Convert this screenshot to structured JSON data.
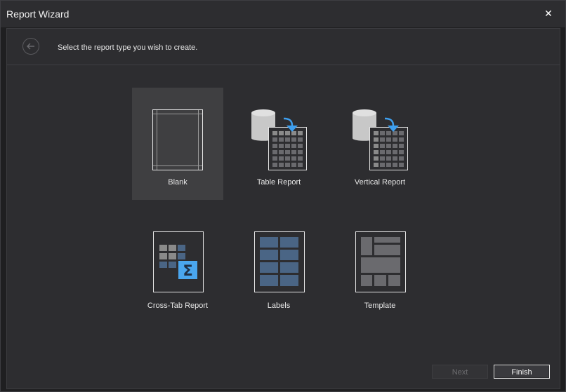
{
  "window": {
    "title": "Report Wizard",
    "close_glyph": "✕"
  },
  "header": {
    "instruction": "Select the report type you wish to create.",
    "back_icon": "arrow-left-circle-icon"
  },
  "report_types": [
    {
      "label": "Blank",
      "icon": "blank-page-icon",
      "selected": true
    },
    {
      "label": "Table Report",
      "icon": "table-report-icon",
      "selected": false
    },
    {
      "label": "Vertical Report",
      "icon": "vertical-report-icon",
      "selected": false
    },
    {
      "label": "Cross-Tab Report",
      "icon": "cross-tab-report-icon",
      "selected": false
    },
    {
      "label": "Labels",
      "icon": "labels-icon",
      "selected": false
    },
    {
      "label": "Template",
      "icon": "template-icon",
      "selected": false
    }
  ],
  "footer": {
    "next_label": "Next",
    "finish_label": "Finish",
    "next_enabled": false
  },
  "colors": {
    "background": "#2d2d30",
    "selected_tile": "#3f3f41",
    "accent_arrow": "#3ea0f0",
    "cell_blue": "#4a6585"
  }
}
